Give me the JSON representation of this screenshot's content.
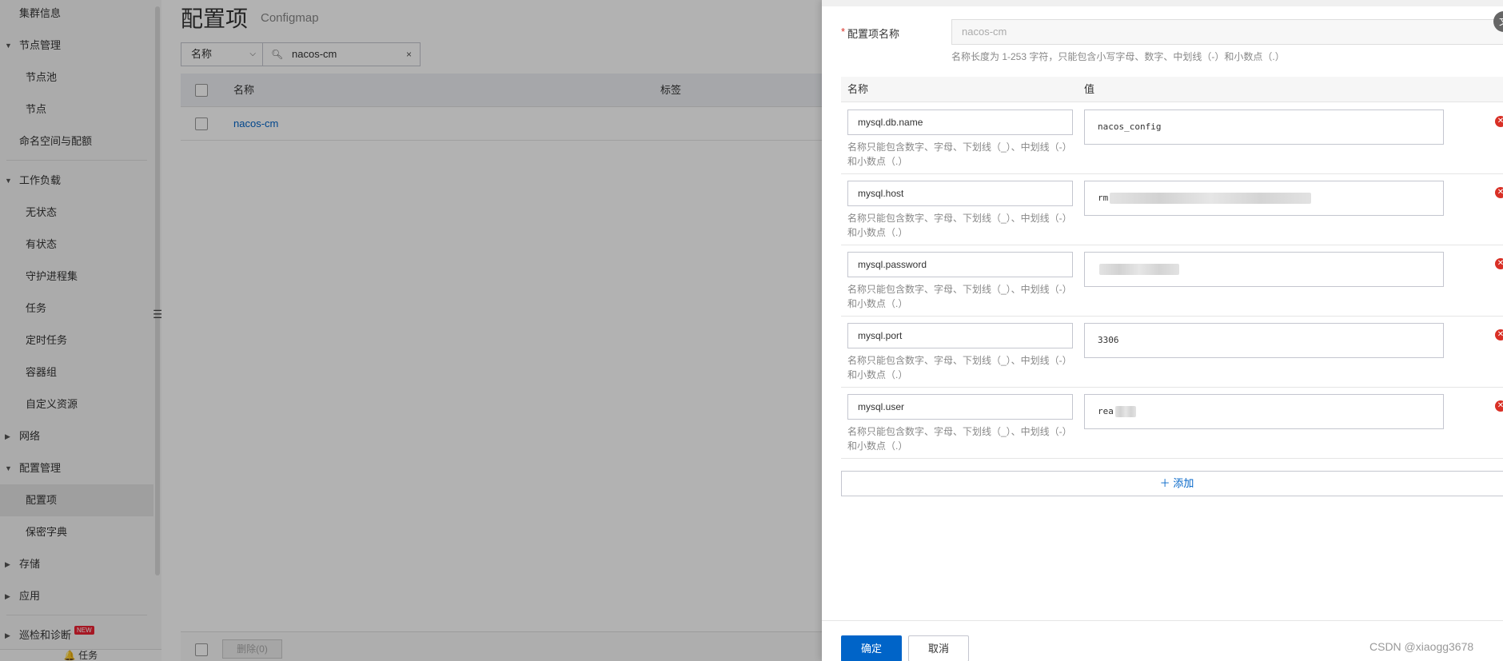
{
  "sidebar": {
    "items": [
      {
        "label": "集群信息"
      },
      {
        "label": "节点管理"
      },
      {
        "label": "节点池"
      },
      {
        "label": "节点"
      },
      {
        "label": "命名空间与配额"
      },
      {
        "label": "工作负载"
      },
      {
        "label": "无状态"
      },
      {
        "label": "有状态"
      },
      {
        "label": "守护进程集"
      },
      {
        "label": "任务"
      },
      {
        "label": "定时任务"
      },
      {
        "label": "容器组"
      },
      {
        "label": "自定义资源"
      },
      {
        "label": "网络"
      },
      {
        "label": "配置管理"
      },
      {
        "label": "配置项"
      },
      {
        "label": "保密字典"
      },
      {
        "label": "存储"
      },
      {
        "label": "应用"
      },
      {
        "label": "巡检和诊断"
      }
    ],
    "new_badge": "NEW",
    "bottom_label": "任务"
  },
  "main": {
    "title": "配置项",
    "subtitle": "Configmap",
    "filter": {
      "selected": "名称"
    },
    "search": {
      "value": "nacos-cm"
    },
    "table": {
      "columns": [
        "名称",
        "标签"
      ],
      "rows": [
        {
          "name": "nacos-cm"
        }
      ]
    },
    "footer": {
      "delete_label": "删除(0)"
    }
  },
  "drawer": {
    "name_label": "配置项名称",
    "name_value": "nacos-cm",
    "name_hint": "名称长度为 1-253 字符，只能包含小写字母、数字、中划线（-）和小数点（.）",
    "corner_icon": "文",
    "kv_columns": {
      "key": "名称",
      "value": "值"
    },
    "key_hint": "名称只能包含数字、字母、下划线（_）、中划线（-）和小数点（.）",
    "entries": [
      {
        "key": "mysql.db.name",
        "value": "nacos_config"
      },
      {
        "key": "mysql.host",
        "value": "rm"
      },
      {
        "key": "mysql.password",
        "value": ""
      },
      {
        "key": "mysql.port",
        "value": "3306"
      },
      {
        "key": "mysql.user",
        "value": "rea"
      }
    ],
    "add_label": "添加",
    "ok_label": "确定",
    "cancel_label": "取消",
    "watermark": "CSDN @xiaogg3678"
  },
  "colors": {
    "primary": "#0064c8",
    "danger": "#d93026"
  }
}
